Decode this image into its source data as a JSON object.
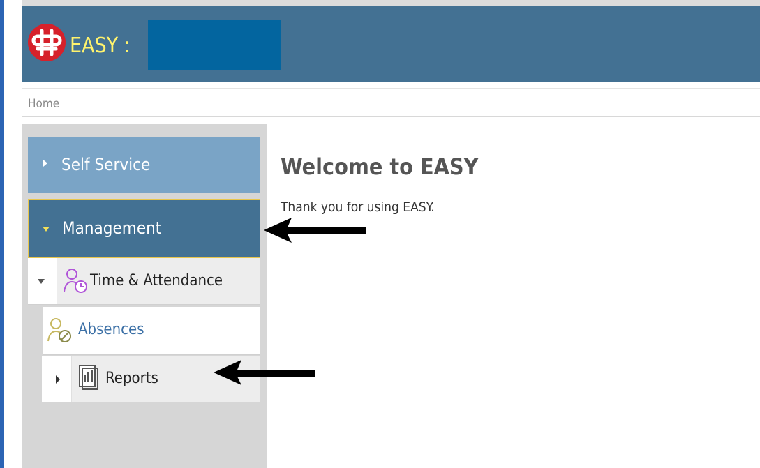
{
  "app": {
    "title": "EASY :",
    "brand_color": "#437193",
    "title_color": "#fff36d"
  },
  "breadcrumb": "Home",
  "sidebar": {
    "self_service": {
      "label": "Self Service",
      "icon": "chevron-right-icon"
    },
    "management": {
      "label": "Management",
      "icon": "chevron-down-icon"
    },
    "time_attendance": {
      "label": "Time & Attendance",
      "icon": "time-attendance-icon"
    },
    "absences": {
      "label": "Absences",
      "icon": "absences-icon"
    },
    "reports": {
      "label": "Reports",
      "icon": "reports-icon"
    }
  },
  "main": {
    "heading": "Welcome to EASY",
    "message": "Thank you for using EASY."
  },
  "annotations": {
    "arrow_color": "#000000"
  }
}
